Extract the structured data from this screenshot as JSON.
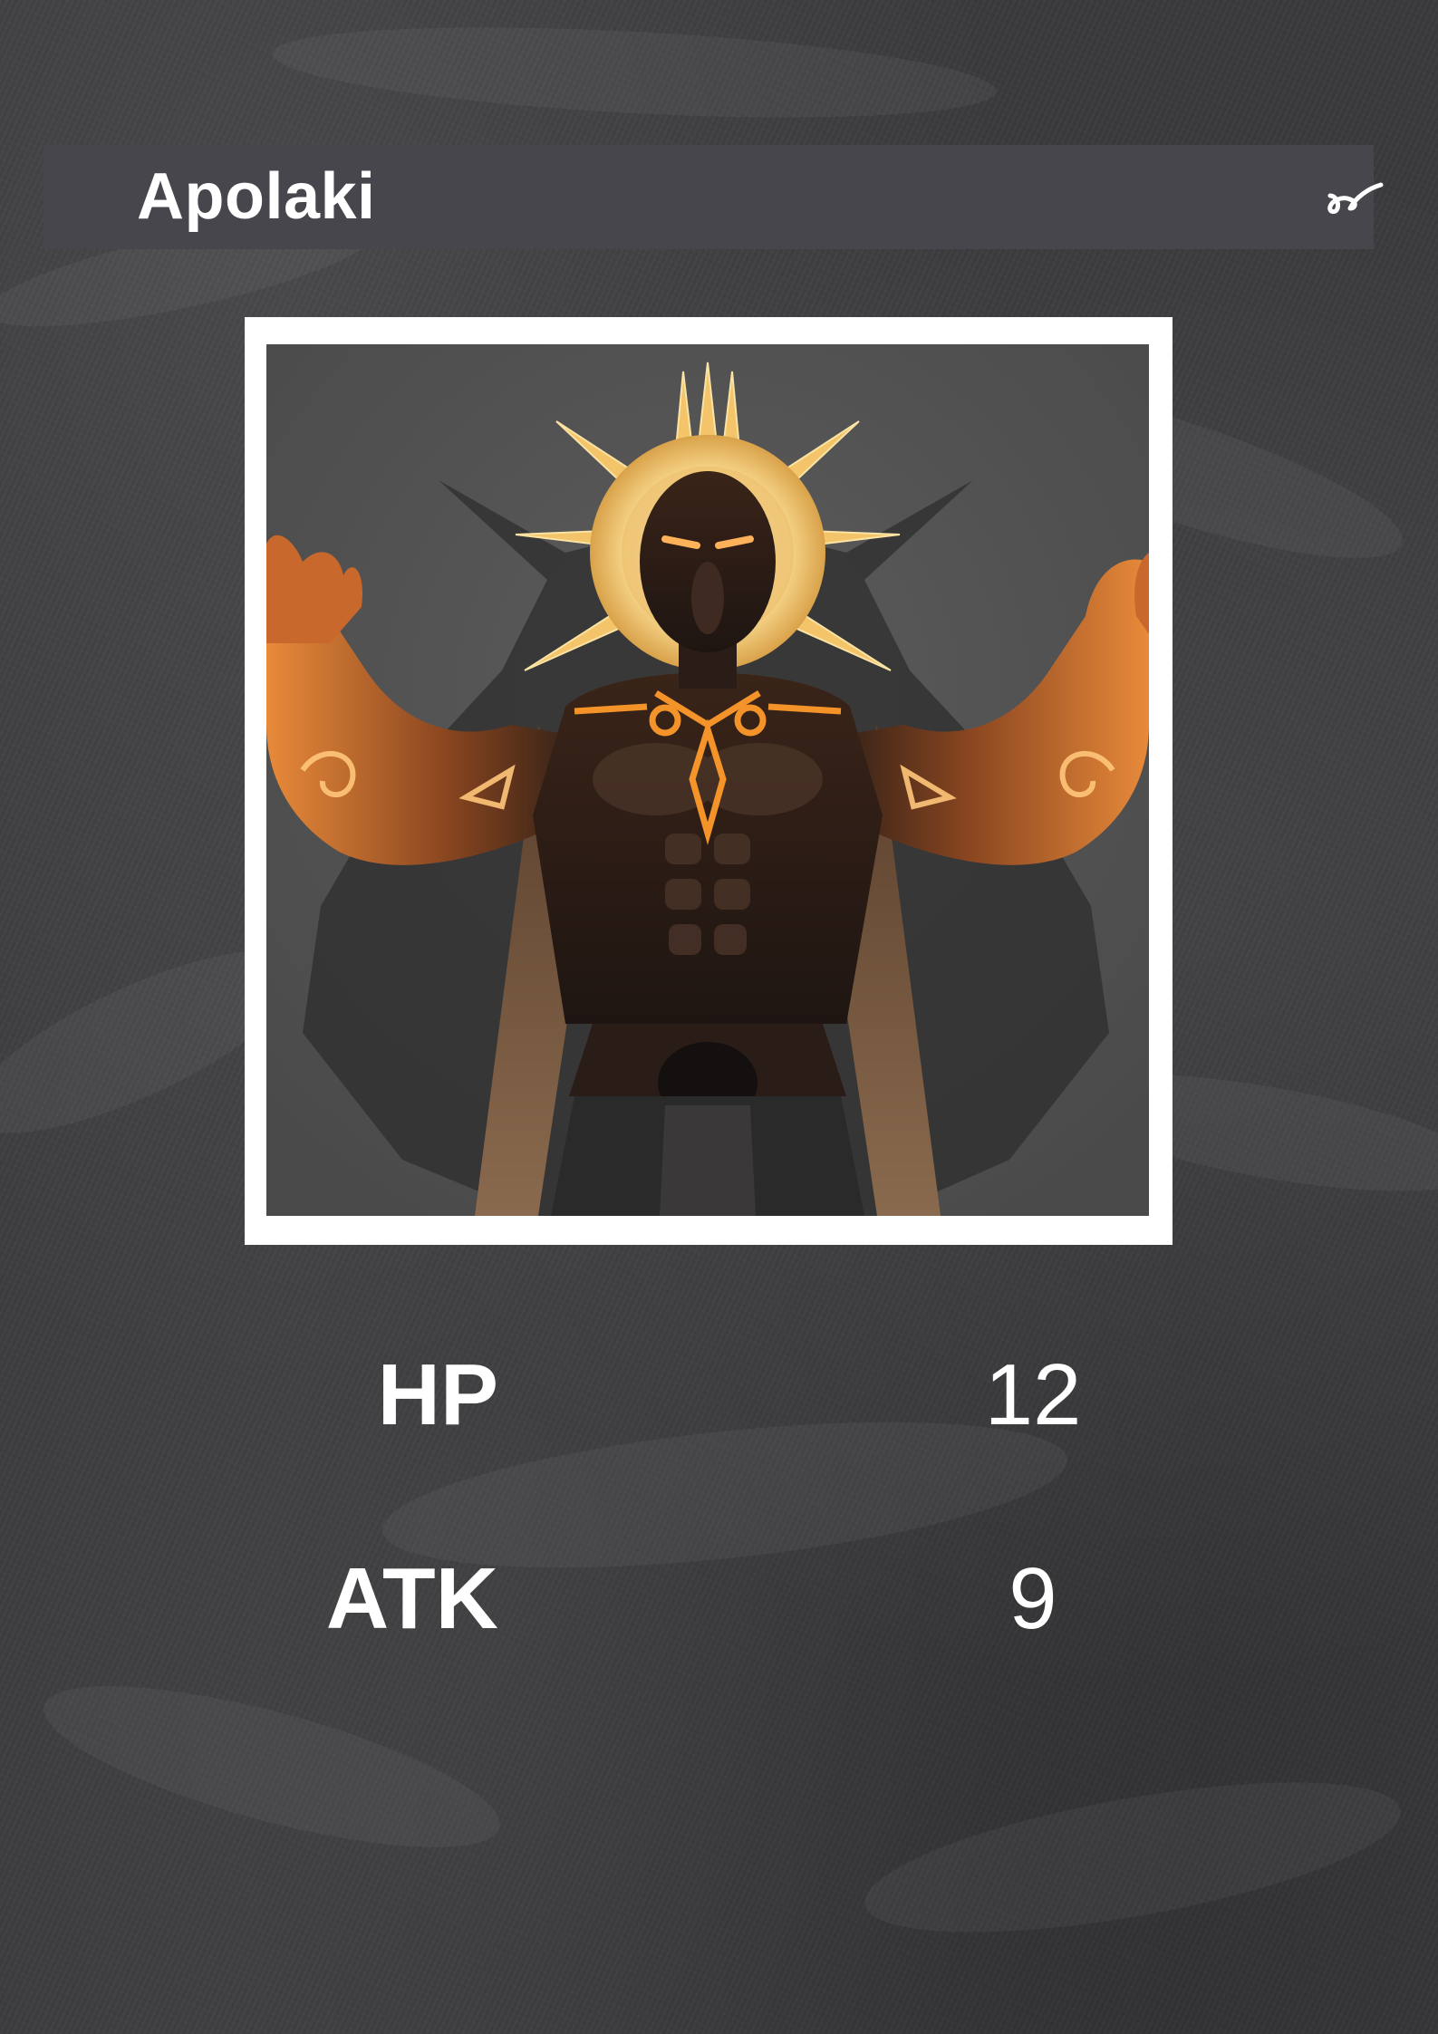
{
  "card": {
    "name": "Apolaki",
    "symbol_icon": "baybayin-glyph-icon",
    "portrait": {
      "subject": "sun-god-figure",
      "halo_color": "#f3c46a",
      "glow_color": "#ff9a2a",
      "skin_color": "#2e1d16",
      "backdrop_color": "#555555"
    }
  },
  "stats": [
    {
      "label": "HP",
      "value": "12"
    },
    {
      "label": "ATK",
      "value": "9"
    }
  ],
  "colors": {
    "background": "#3a393c",
    "title_bar": "#47464c",
    "text": "#ffffff",
    "frame": "#ffffff"
  }
}
